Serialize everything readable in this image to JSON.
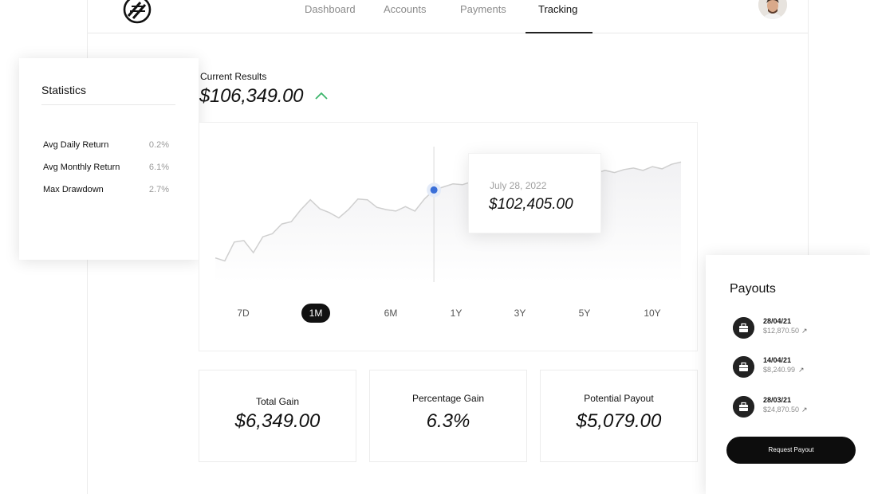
{
  "nav": {
    "items": [
      "Dashboard",
      "Accounts",
      "Payments",
      "Tracking"
    ],
    "active": "Tracking"
  },
  "statistics": {
    "title": "Statistics",
    "rows": [
      {
        "label": "Avg Daily Return",
        "value": "0.2%"
      },
      {
        "label": "Avg Monthly Return",
        "value": "6.1%"
      },
      {
        "label": "Max Drawdown",
        "value": "2.7%"
      }
    ]
  },
  "results": {
    "label": "Current Results",
    "value": "$106,349.00",
    "trend": "up",
    "trend_color": "#3bb56b"
  },
  "chart": {
    "tooltip_date": "July 28, 2022",
    "tooltip_value": "$102,405.00",
    "ranges": [
      "7D",
      "1M",
      "6M",
      "1Y",
      "3Y",
      "5Y",
      "10Y"
    ],
    "active_range": "1M",
    "marker_color": "#3a6fd8"
  },
  "chart_data": {
    "type": "line",
    "x": [
      1,
      2,
      3,
      4,
      5,
      6,
      7,
      8,
      9,
      10,
      11,
      12,
      13,
      14,
      15,
      16,
      17,
      18,
      19,
      20,
      21,
      22,
      23,
      24,
      25,
      26,
      27,
      28,
      29,
      30,
      31,
      32,
      33,
      34,
      35,
      36,
      37,
      38,
      39,
      40,
      41,
      42,
      43,
      44,
      45,
      46,
      47,
      48,
      49,
      50
    ],
    "values": [
      96.2,
      95.8,
      98.3,
      98.5,
      96.9,
      99.0,
      99.4,
      100.7,
      101.0,
      102.6,
      103.9,
      102.7,
      102.2,
      101.5,
      102.6,
      104.0,
      103.9,
      102.9,
      102.6,
      102.4,
      103.0,
      102.4,
      104.0,
      105.2,
      105.6,
      106.0,
      105.9,
      106.3,
      106.0,
      106.6,
      106.4,
      106.6,
      106.9,
      106.6,
      107.4,
      107.1,
      107.5,
      107.3,
      107.2,
      107.6,
      107.4,
      107.8,
      107.5,
      107.9,
      108.1,
      107.8,
      108.3,
      108.0,
      108.6,
      108.9
    ],
    "ylim": [
      93,
      112
    ],
    "highlight_index": 23
  },
  "metrics": [
    {
      "label": "Total Gain",
      "value": "$6,349.00"
    },
    {
      "label": "Percentage Gain",
      "value": "6.3%"
    },
    {
      "label": "Potential Payout",
      "value": "$5,079.00"
    }
  ],
  "payouts": {
    "title": "Payouts",
    "items": [
      {
        "date": "28/04/21",
        "amount": "$12,870.50"
      },
      {
        "date": "14/04/21",
        "amount": "$8,240.99"
      },
      {
        "date": "28/03/21",
        "amount": "$24,870.50"
      }
    ],
    "request_label": "Request Payout"
  }
}
